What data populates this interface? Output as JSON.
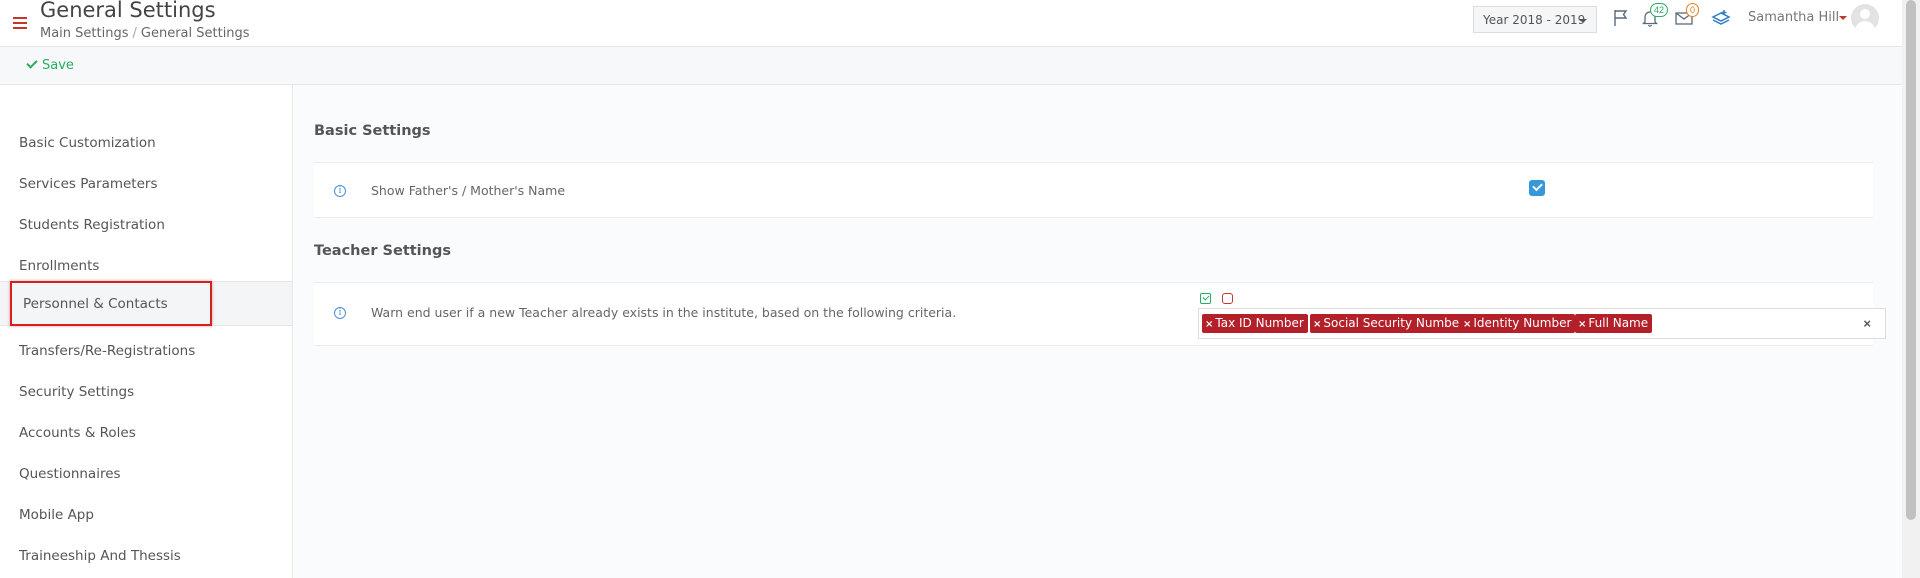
{
  "header": {
    "title": "General Settings",
    "breadcrumb": [
      "Main Settings",
      "General Settings"
    ],
    "year_select": "Year 2018 - 2019",
    "notifications_count": "42",
    "messages_count": "0",
    "user_name": "Samantha Hill"
  },
  "toolbar": {
    "save_label": "Save"
  },
  "sidebar": {
    "items": [
      {
        "label": "Basic Customization"
      },
      {
        "label": "Services Parameters"
      },
      {
        "label": "Students Registration"
      },
      {
        "label": "Enrollments"
      },
      {
        "label": "Personnel & Contacts",
        "active": true
      },
      {
        "label": "Transfers/Re-Registrations"
      },
      {
        "label": "Security Settings"
      },
      {
        "label": "Accounts & Roles"
      },
      {
        "label": "Questionnaires"
      },
      {
        "label": "Mobile App"
      },
      {
        "label": "Traineeship And Thessis"
      }
    ]
  },
  "main": {
    "basic_settings": {
      "title": "Basic Settings",
      "rows": [
        {
          "label": "Show Father's / Mother's Name",
          "checked": true
        }
      ]
    },
    "teacher_settings": {
      "title": "Teacher Settings",
      "rows": [
        {
          "label": "Warn end user if a new Teacher already exists in the institute, based on the following criteria.",
          "tags": [
            "Tax ID Number",
            "Social Security Number",
            "Identity Number",
            "Full Name"
          ],
          "clear_symbol": "×"
        }
      ]
    }
  },
  "colors": {
    "accent_red": "#b3202a",
    "accent_green": "#27ae60",
    "checkbox_blue": "#3498db"
  }
}
